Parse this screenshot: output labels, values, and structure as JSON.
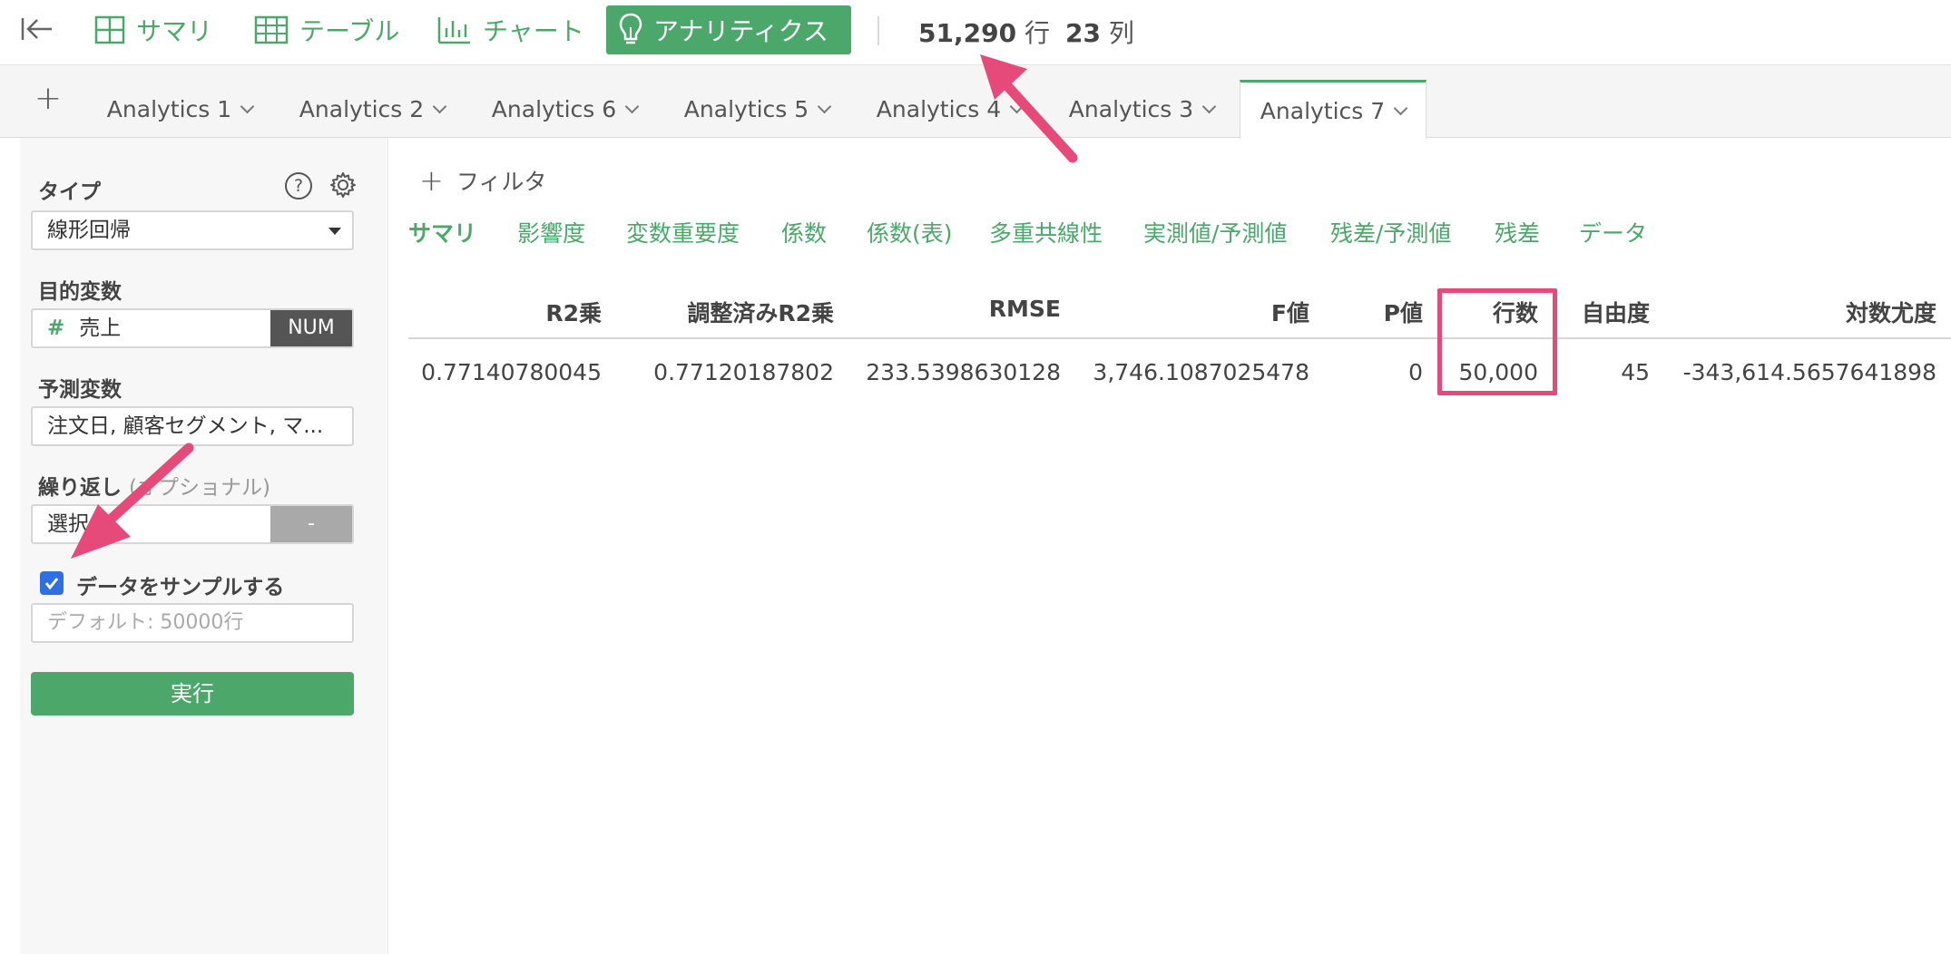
{
  "toolbar": {
    "views": [
      {
        "label": "サマリ",
        "icon": "grid-icon"
      },
      {
        "label": "テーブル",
        "icon": "table-icon"
      },
      {
        "label": "チャート",
        "icon": "bar-chart-icon"
      },
      {
        "label": "アナリティクス",
        "icon": "lightbulb-icon",
        "active": true
      }
    ],
    "rows_count": "51,290",
    "rows_unit": "行",
    "cols_count": "23",
    "cols_unit": "列"
  },
  "tabs": [
    {
      "label": "Analytics 1"
    },
    {
      "label": "Analytics 2"
    },
    {
      "label": "Analytics 6"
    },
    {
      "label": "Analytics 5"
    },
    {
      "label": "Analytics 4"
    },
    {
      "label": "Analytics 3"
    },
    {
      "label": "Analytics 7",
      "active": true
    }
  ],
  "sidebar": {
    "type_label": "タイプ",
    "type_value": "線形回帰",
    "target_label": "目的変数",
    "target_hash": "#",
    "target_value": "売上",
    "target_badge": "NUM",
    "predictors_label": "予測変数",
    "predictors_value": "注文日, 顧客セグメント, マ...",
    "repeat_label": "繰り返し",
    "repeat_optional": "(オプショナル)",
    "repeat_value": "選択",
    "repeat_button": "-",
    "sample_checked": true,
    "sample_label": "データをサンプルする",
    "sample_placeholder": "デフォルト: 50000行",
    "run_label": "実行"
  },
  "main": {
    "filter_label": "フィルタ",
    "subtabs": [
      {
        "label": "サマリ",
        "active": true
      },
      {
        "label": "影響度"
      },
      {
        "label": "変数重要度"
      },
      {
        "label": "係数"
      },
      {
        "label": "係数(表)"
      },
      {
        "label": "多重共線性"
      },
      {
        "label": "実測値/予測値"
      },
      {
        "label": "残差/予測値"
      },
      {
        "label": "残差"
      },
      {
        "label": "データ"
      }
    ],
    "table": {
      "columns": [
        "R2乗",
        "調整済みR2乗",
        "RMSE",
        "F値",
        "P値",
        "行数",
        "自由度",
        "対数尤度"
      ],
      "rows": [
        [
          "0.77140780045",
          "0.77120187802",
          "233.5398630128",
          "3,746.1087025478",
          "0",
          "50,000",
          "45",
          "-343,614.5657641898"
        ]
      ]
    }
  },
  "colors": {
    "accent": "#4ca86a",
    "highlight": "#e64a7b",
    "checkbox": "#2f6fe0"
  }
}
